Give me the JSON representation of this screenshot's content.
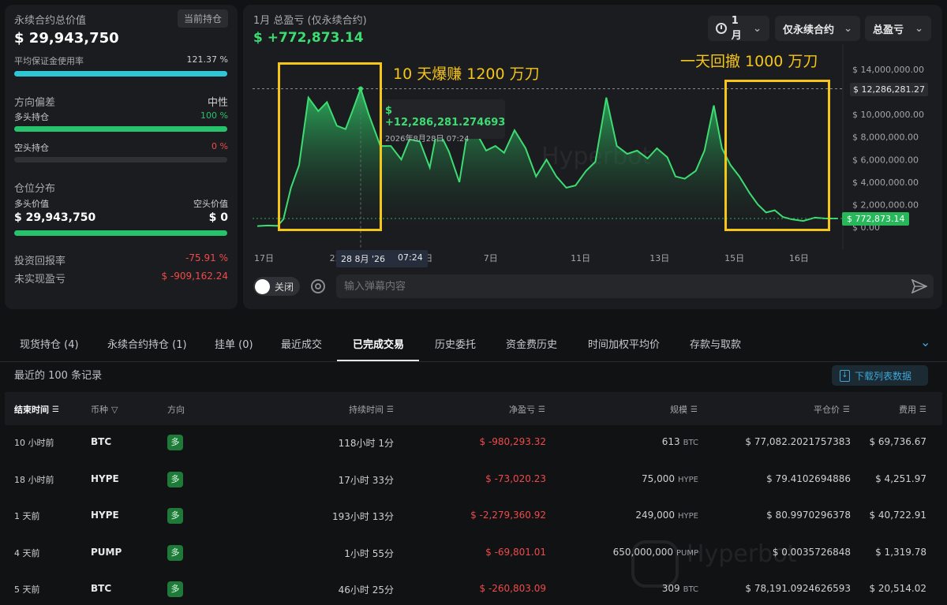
{
  "left": {
    "total_label": "永续合约总价值",
    "holding_btn": "当前持仓",
    "total_value": "$ 29,943,750",
    "margin_label": "平均保证金使用率",
    "margin_value": "121.37 %",
    "margin_fraction": 1.0,
    "bias_label": "方向偏差",
    "bias_value": "中性",
    "long_label": "多头持仓",
    "long_value": "100 %",
    "long_fraction": 1.0,
    "short_label": "空头持仓",
    "short_value": "0 %",
    "short_fraction": 0.0,
    "dist_label": "仓位分布",
    "long_val_label": "多头价值",
    "short_val_label": "空头价值",
    "long_val": "$ 29,943,750",
    "short_val": "$ 0",
    "roi_label": "投资回报率",
    "roi_value": "-75.91 %",
    "upnl_label": "未实现盈亏",
    "upnl_value": "$ -909,162.24"
  },
  "chart_panel": {
    "title": "1月 总盈亏 (仅永续合约)",
    "pnl": "$ +772,873.14",
    "period": "1月",
    "filter": "仅永续合约",
    "metric": "总盈亏",
    "annotation_left": "10 天爆赚 1200 万刀",
    "annotation_right": "一天回撤 1000 万刀",
    "tooltip_value": "$ +12,286,281.274693",
    "tooltip_date": "2026年8月28日 07:24",
    "max_marker": "$ 12,286,281.27",
    "current_marker": "$ 772,873.14",
    "crosshair_date": "28 8月 '26",
    "crosshair_time": "07:24",
    "toggle_label": "关闭",
    "danmaku_placeholder": "输入弹幕内容",
    "watermark": "Hyperbot",
    "colors": {
      "line": "#3ddc72",
      "accent": "#f5c518",
      "down": "#f04a4a"
    }
  },
  "chart_data": {
    "type": "area",
    "ylim": [
      0,
      14000000
    ],
    "y_ticks": [
      "14,000,000.00",
      "12,000,000.00",
      "10,000,000.00",
      "8,000,000.00",
      "6,000,000.00",
      "4,000,000.00",
      "2,000,000.00",
      "0.00"
    ],
    "y_tick_values": [
      14000000,
      12000000,
      10000000,
      8000000,
      6000000,
      4000000,
      2000000,
      0
    ],
    "x_ticks": [
      "17日",
      "23日",
      "5日",
      "7日",
      "11日",
      "13日",
      "15日",
      "16日"
    ],
    "x_tick_positions": [
      0,
      0.13,
      0.283,
      0.395,
      0.545,
      0.681,
      0.81,
      0.921
    ],
    "x": [
      0,
      0.018,
      0.035,
      0.045,
      0.058,
      0.072,
      0.088,
      0.105,
      0.12,
      0.137,
      0.152,
      0.163,
      0.178,
      0.192,
      0.212,
      0.23,
      0.248,
      0.262,
      0.28,
      0.297,
      0.31,
      0.33,
      0.348,
      0.362,
      0.376,
      0.394,
      0.41,
      0.425,
      0.443,
      0.462,
      0.48,
      0.498,
      0.515,
      0.532,
      0.548,
      0.566,
      0.582,
      0.601,
      0.619,
      0.637,
      0.654,
      0.672,
      0.688,
      0.706,
      0.72,
      0.736,
      0.755,
      0.77,
      0.786,
      0.8,
      0.815,
      0.83,
      0.848,
      0.862,
      0.876,
      0.891,
      0.905,
      0.92,
      0.94,
      0.96,
      0.978,
      1.0
    ],
    "values": [
      100000,
      150000,
      120000,
      700000,
      3500000,
      5500000,
      11500000,
      10300000,
      11100000,
      9000000,
      8700000,
      10200000,
      12290000,
      10000000,
      7200000,
      7200000,
      6000000,
      7800000,
      7600000,
      5300000,
      8800000,
      6700000,
      4000000,
      8500000,
      8500000,
      6800000,
      7200000,
      6600000,
      8600000,
      7000000,
      4500000,
      6000000,
      4500000,
      3500000,
      3700000,
      5000000,
      5800000,
      11500000,
      7200000,
      6500000,
      6800000,
      6100000,
      7000000,
      6200000,
      4500000,
      4300000,
      5000000,
      6800000,
      10800000,
      7000000,
      5500000,
      4500000,
      3000000,
      2000000,
      1300000,
      1500000,
      900000,
      700000,
      550000,
      850000,
      772873,
      772873
    ],
    "max_value": 12286281.27,
    "current_value": 772873.14
  },
  "tabs": [
    "现货持仓 (4)",
    "永续合约持仓 (1)",
    "挂单 (0)",
    "最近成交",
    "已完成交易",
    "历史委托",
    "资金费历史",
    "时间加权平均价",
    "存款与取款"
  ],
  "table": {
    "caption": "最近的 100 条记录",
    "download": "下载列表数据",
    "headers": [
      "结束时间",
      "币种",
      "方向",
      "持续时间",
      "净盈亏",
      "规模",
      "平仓价",
      "费用"
    ],
    "rows": [
      {
        "time": "10 小时前",
        "coin": "BTC",
        "side": "多",
        "duration": "118小时 1分",
        "pnl": "$ -980,293.32",
        "size": "613",
        "unit": "BTC",
        "price": "$ 77,082.2021757383",
        "fee": "$ 69,736.67"
      },
      {
        "time": "18 小时前",
        "coin": "HYPE",
        "side": "多",
        "duration": "17小时 33分",
        "pnl": "$ -73,020.23",
        "size": "75,000",
        "unit": "HYPE",
        "price": "$ 79.4102694886",
        "fee": "$ 4,251.97"
      },
      {
        "time": "1 天前",
        "coin": "HYPE",
        "side": "多",
        "duration": "193小时 13分",
        "pnl": "$ -2,279,360.92",
        "size": "249,000",
        "unit": "HYPE",
        "price": "$ 80.9970296378",
        "fee": "$ 40,722.91"
      },
      {
        "time": "4 天前",
        "coin": "PUMP",
        "side": "多",
        "duration": "1小时 55分",
        "pnl": "$ -69,801.01",
        "size": "650,000,000",
        "unit": "PUMP",
        "price": "$ 0.0035726848",
        "fee": "$ 1,319.78"
      },
      {
        "time": "5 天前",
        "coin": "BTC",
        "side": "多",
        "duration": "46小时 25分",
        "pnl": "$ -260,803.09",
        "size": "309",
        "unit": "BTC",
        "price": "$ 78,191.0924626593",
        "fee": "$ 20,514.02"
      }
    ]
  }
}
